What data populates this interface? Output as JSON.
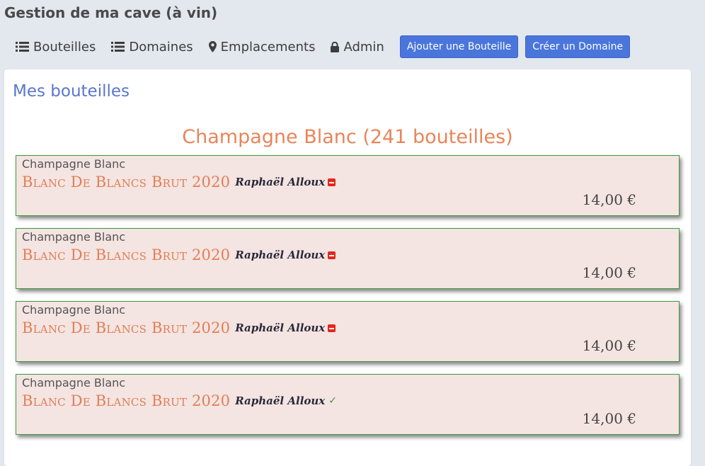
{
  "app": {
    "title": "Gestion de ma cave (à vin)"
  },
  "nav": {
    "bouteilles": "Bouteilles",
    "domaines": "Domaines",
    "emplacements": "Emplacements",
    "admin": "Admin",
    "add_bottle": "Ajouter une Bouteille",
    "create_domain": "Créer un Domaine"
  },
  "page": {
    "title": "Mes bouteilles",
    "group_title": "Champagne Blanc (241 bouteilles)"
  },
  "bottles": [
    {
      "type": "Champagne Blanc",
      "name": "Blanc De Blancs Brut 2020",
      "producer": "Raphaël Alloux",
      "status": "unavailable",
      "price": "14,00 €"
    },
    {
      "type": "Champagne Blanc",
      "name": "Blanc De Blancs Brut 2020",
      "producer": "Raphaël Alloux",
      "status": "unavailable",
      "price": "14,00 €"
    },
    {
      "type": "Champagne Blanc",
      "name": "Blanc De Blancs Brut 2020",
      "producer": "Raphaël Alloux",
      "status": "unavailable",
      "price": "14,00 €"
    },
    {
      "type": "Champagne Blanc",
      "name": "Blanc De Blancs Brut 2020",
      "producer": "Raphaël Alloux",
      "status": "available",
      "status_mark": "✓",
      "price": "14,00 €"
    }
  ],
  "colors": {
    "accent": "#4a76dc",
    "heading": "#5a76cf",
    "group": "#e8855a",
    "card_bg": "#f4e4e2",
    "card_border": "#3d9a3d"
  }
}
